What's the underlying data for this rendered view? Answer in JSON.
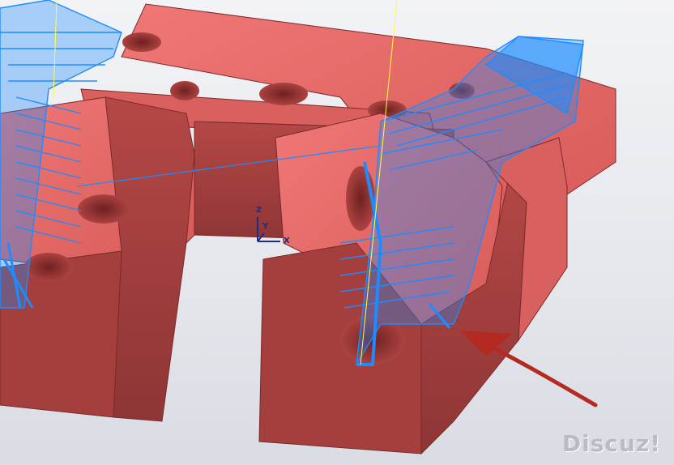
{
  "viewport": {
    "background_top": "#f2f3f6",
    "background_bottom": "#d9dce3"
  },
  "colors": {
    "part_face_light": "#e86a68",
    "part_face_mid": "#c9504f",
    "part_face_dark": "#9b3b3b",
    "toolpath": "#1e8cff",
    "tool_axis": "#ffff44",
    "annotation_arrow": "#b52a20",
    "triad": "#1a2c8c"
  },
  "triad": {
    "x_label": "X",
    "y_label": "Y",
    "z_label": "Z"
  },
  "watermark": {
    "text": "Discuz!"
  }
}
